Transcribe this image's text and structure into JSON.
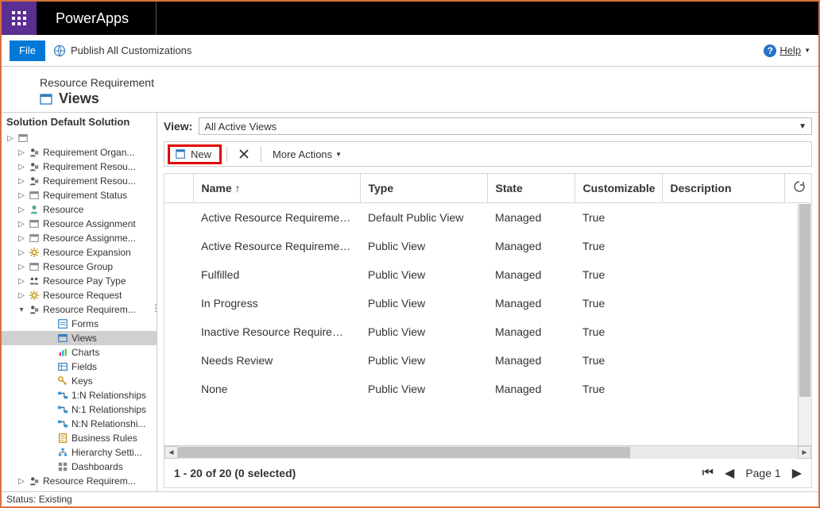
{
  "header": {
    "app_name": "PowerApps"
  },
  "commandbar": {
    "file_label": "File",
    "publish_label": "Publish All Customizations",
    "help_label": "Help"
  },
  "breadcrumb": {
    "entity": "Resource Requirement",
    "page_title": "Views"
  },
  "sidebar": {
    "header": "Solution Default Solution",
    "nodes": [
      {
        "level": 0,
        "label": "",
        "icon": "entity",
        "expandable": true
      },
      {
        "level": 1,
        "label": "Requirement Organ...",
        "icon": "person"
      },
      {
        "level": 1,
        "label": "Requirement Resou...",
        "icon": "person"
      },
      {
        "level": 1,
        "label": "Requirement Resou...",
        "icon": "person"
      },
      {
        "level": 1,
        "label": "Requirement Status",
        "icon": "entity"
      },
      {
        "level": 1,
        "label": "Resource",
        "icon": "resource"
      },
      {
        "level": 1,
        "label": "Resource Assignment",
        "icon": "entity"
      },
      {
        "level": 1,
        "label": "Resource Assignme...",
        "icon": "entity"
      },
      {
        "level": 1,
        "label": "Resource Expansion",
        "icon": "gear"
      },
      {
        "level": 1,
        "label": "Resource Group",
        "icon": "entity"
      },
      {
        "level": 1,
        "label": "Resource Pay Type",
        "icon": "people"
      },
      {
        "level": 1,
        "label": "Resource Request",
        "icon": "gear"
      },
      {
        "level": 1,
        "label": "Resource Requirem...",
        "icon": "person",
        "expanded": true
      },
      {
        "level": 2,
        "label": "Forms",
        "icon": "form"
      },
      {
        "level": 2,
        "label": "Views",
        "icon": "view",
        "selected": true
      },
      {
        "level": 2,
        "label": "Charts",
        "icon": "chart"
      },
      {
        "level": 2,
        "label": "Fields",
        "icon": "field"
      },
      {
        "level": 2,
        "label": "Keys",
        "icon": "key"
      },
      {
        "level": 2,
        "label": "1:N Relationships",
        "icon": "rel"
      },
      {
        "level": 2,
        "label": "N:1 Relationships",
        "icon": "rel"
      },
      {
        "level": 2,
        "label": "N:N Relationshi...",
        "icon": "rel"
      },
      {
        "level": 2,
        "label": "Business Rules",
        "icon": "rule"
      },
      {
        "level": 2,
        "label": "Hierarchy Setti...",
        "icon": "hier"
      },
      {
        "level": 2,
        "label": "Dashboards",
        "icon": "dash"
      },
      {
        "level": 1,
        "label": "Resource Requirem...",
        "icon": "person"
      }
    ]
  },
  "view_filter": {
    "label": "View:",
    "selected": "All Active Views"
  },
  "toolbar": {
    "new_label": "New",
    "more_actions_label": "More Actions"
  },
  "grid": {
    "columns": {
      "name": "Name",
      "sort": "↑",
      "type": "Type",
      "state": "State",
      "customizable": "Customizable",
      "description": "Description"
    },
    "rows": [
      {
        "name": "Active Resource Requirements",
        "type": "Default Public View",
        "state": "Managed",
        "customizable": "True",
        "description": ""
      },
      {
        "name": "Active Resource Requirements ...",
        "type": "Public View",
        "state": "Managed",
        "customizable": "True",
        "description": ""
      },
      {
        "name": "Fulfilled",
        "type": "Public View",
        "state": "Managed",
        "customizable": "True",
        "description": ""
      },
      {
        "name": "In Progress",
        "type": "Public View",
        "state": "Managed",
        "customizable": "True",
        "description": ""
      },
      {
        "name": "Inactive Resource Requirements",
        "type": "Public View",
        "state": "Managed",
        "customizable": "True",
        "description": ""
      },
      {
        "name": "Needs Review",
        "type": "Public View",
        "state": "Managed",
        "customizable": "True",
        "description": ""
      },
      {
        "name": "None",
        "type": "Public View",
        "state": "Managed",
        "customizable": "True",
        "description": ""
      }
    ]
  },
  "pager": {
    "status": "1 - 20 of 20 (0 selected)",
    "page_label": "Page 1"
  },
  "statusbar": {
    "text": "Status: Existing"
  }
}
